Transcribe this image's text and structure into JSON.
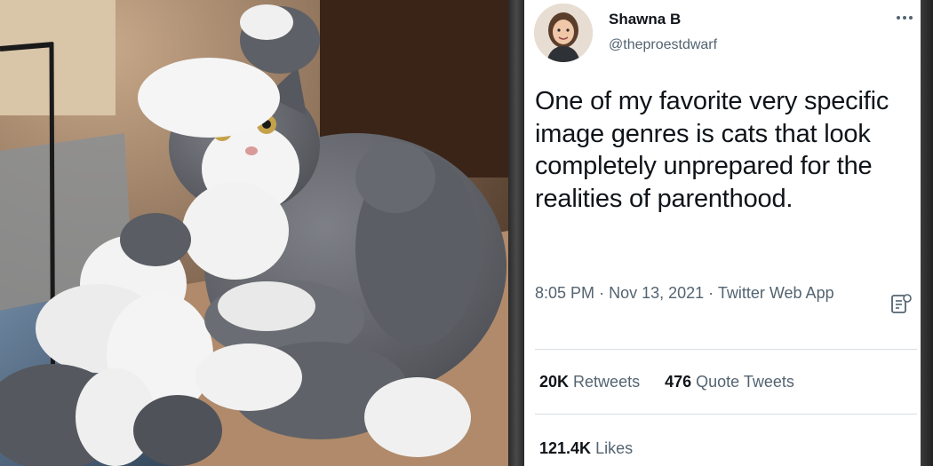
{
  "photo": {
    "alt": "cat-with-kittens-photo"
  },
  "tweet": {
    "author": {
      "display_name": "Shawna B",
      "handle": "@theproestdwarf"
    },
    "text": "One of my favorite very specific image genres is cats that look completely unprepared for the realities of parenthood.",
    "time": "8:05 PM",
    "date": "Nov 13, 2021",
    "source": "Twitter Web App",
    "separator": "·",
    "stats": {
      "retweets_count": "20K",
      "retweets_label": "Retweets",
      "quotes_count": "476",
      "quotes_label": "Quote Tweets",
      "likes_count": "121.4K",
      "likes_label": "Likes"
    },
    "icons": {
      "more": "more-dots-icon",
      "analytics": "analytics-icon"
    },
    "colors": {
      "text_primary": "#0f1419",
      "text_secondary": "#536471",
      "divider": "#d7dde2"
    }
  }
}
